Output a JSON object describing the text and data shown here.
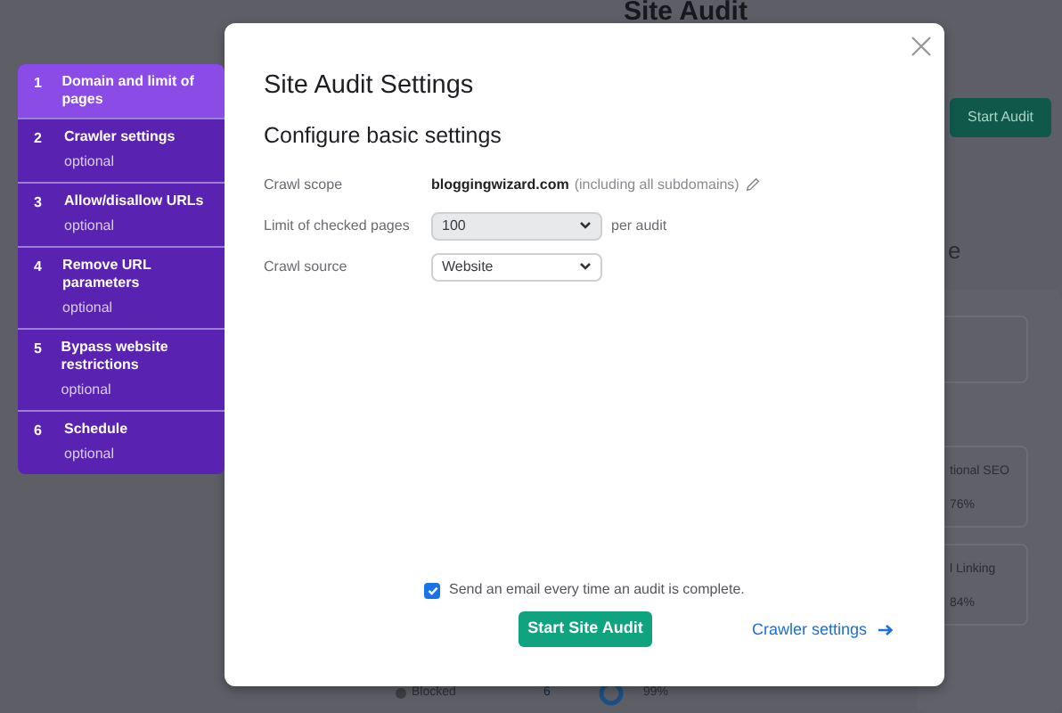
{
  "background": {
    "heading": "Site Audit",
    "start_button": "Start Audit",
    "heading_fragment": "e",
    "cards": [
      {
        "label": "tional SEO",
        "value": "76%"
      },
      {
        "label": "l Linking",
        "value": "84%"
      }
    ],
    "blocked": {
      "label": "Blocked",
      "count": "6"
    },
    "percent": "99%"
  },
  "steps": [
    {
      "number": "1",
      "title": "Domain and limit of pages",
      "selected": true
    },
    {
      "number": "2",
      "title": "Crawler settings",
      "subtitle": "optional",
      "selected": false
    },
    {
      "number": "3",
      "title": "Allow/disallow URLs",
      "subtitle": "optional",
      "selected": false
    },
    {
      "number": "4",
      "title": "Remove URL parameters",
      "subtitle": "optional",
      "selected": false
    },
    {
      "number": "5",
      "title": "Bypass website restrictions",
      "subtitle": "optional",
      "selected": false
    },
    {
      "number": "6",
      "title": "Schedule",
      "subtitle": "optional",
      "selected": false
    }
  ],
  "modal": {
    "title": "Site Audit Settings",
    "subtitle": "Configure basic settings",
    "fields": [
      {
        "kind": "scope",
        "label": "Crawl scope",
        "value": "bloggingwizard.com",
        "note": "(including all subdomains)"
      },
      {
        "kind": "select",
        "label": "Limit of checked pages",
        "value": "100",
        "suffix": "per audit",
        "disabled": true
      },
      {
        "kind": "select",
        "label": "Crawl source",
        "value": "Website",
        "disabled": false
      }
    ],
    "email_checkbox": {
      "label": "Send an email every time an audit is complete.",
      "checked": true
    },
    "primary_button": "Start Site Audit",
    "link": "Crawler settings"
  }
}
